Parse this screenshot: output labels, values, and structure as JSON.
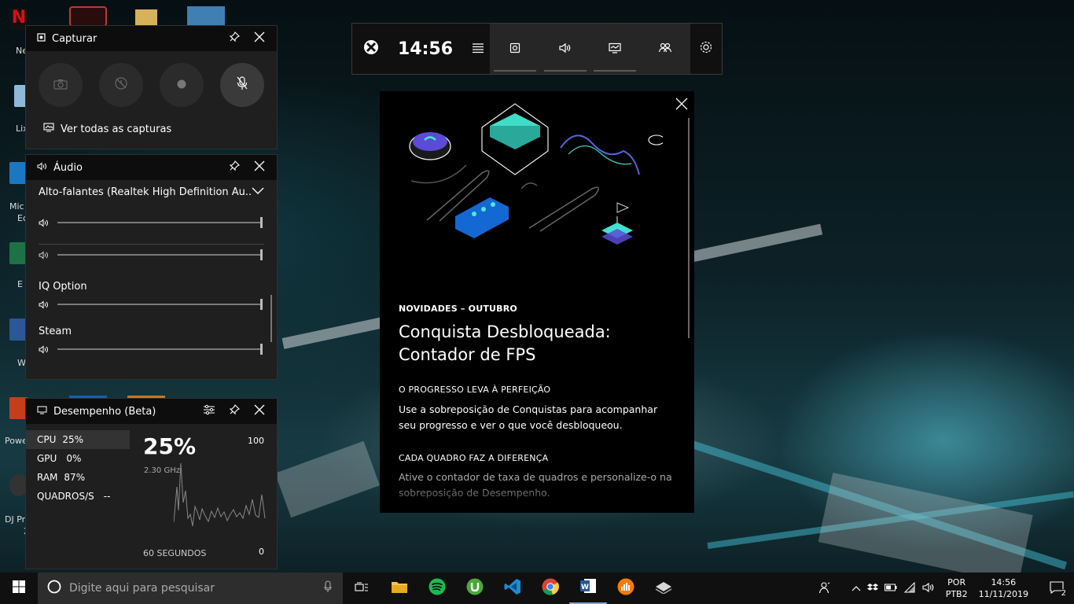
{
  "desktop": {
    "icons": [
      {
        "label": "Ne"
      },
      {
        "label": "Lix"
      },
      {
        "label": "Mic"
      },
      {
        "label": "Ed"
      },
      {
        "label": "E"
      },
      {
        "label": "W"
      },
      {
        "label": "Powe"
      },
      {
        "label": "DJ Pr"
      },
      {
        "label": "2"
      }
    ]
  },
  "gamebar": {
    "time": "14:56"
  },
  "capture": {
    "title": "Capturar",
    "view_all": "Ver todas as capturas"
  },
  "audio": {
    "title": "Áudio",
    "device": "Alto-falantes (Realtek High Definition Au...",
    "apps": [
      {
        "name": "IQ Option"
      },
      {
        "name": "Steam"
      }
    ]
  },
  "performance": {
    "title": "Desempenho (Beta)",
    "items": [
      {
        "label": "CPU",
        "value": "25%"
      },
      {
        "label": "GPU",
        "value": "0%"
      },
      {
        "label": "RAM",
        "value": "87%"
      },
      {
        "label": "QUADROS/S",
        "value": "--"
      }
    ],
    "big_value": "25%",
    "freq": "2.30 GHz",
    "max": "100",
    "min": "0",
    "span": "60 SEGUNDOS"
  },
  "news": {
    "kicker": "NOVIDADES – OUTUBRO",
    "headline": "Conquista Desbloqueada: Contador de FPS",
    "section1_title": "O PROGRESSO LEVA À PERFEIÇÃO",
    "section1_body": "Use a sobreposição de Conquistas para acompanhar seu progresso e ver o que você desbloqueou.",
    "section2_title": "CADA QUADRO FAZ A DIFERENÇA",
    "section2_body": "Ative o contador de taxa de quadros e personalize-o na sobreposição de Desempenho."
  },
  "taskbar": {
    "search_placeholder": "Digite aqui para pesquisar",
    "lang_top": "POR",
    "lang_bottom": "PTB2",
    "time": "14:56",
    "date": "11/11/2019",
    "notifications": "2"
  }
}
